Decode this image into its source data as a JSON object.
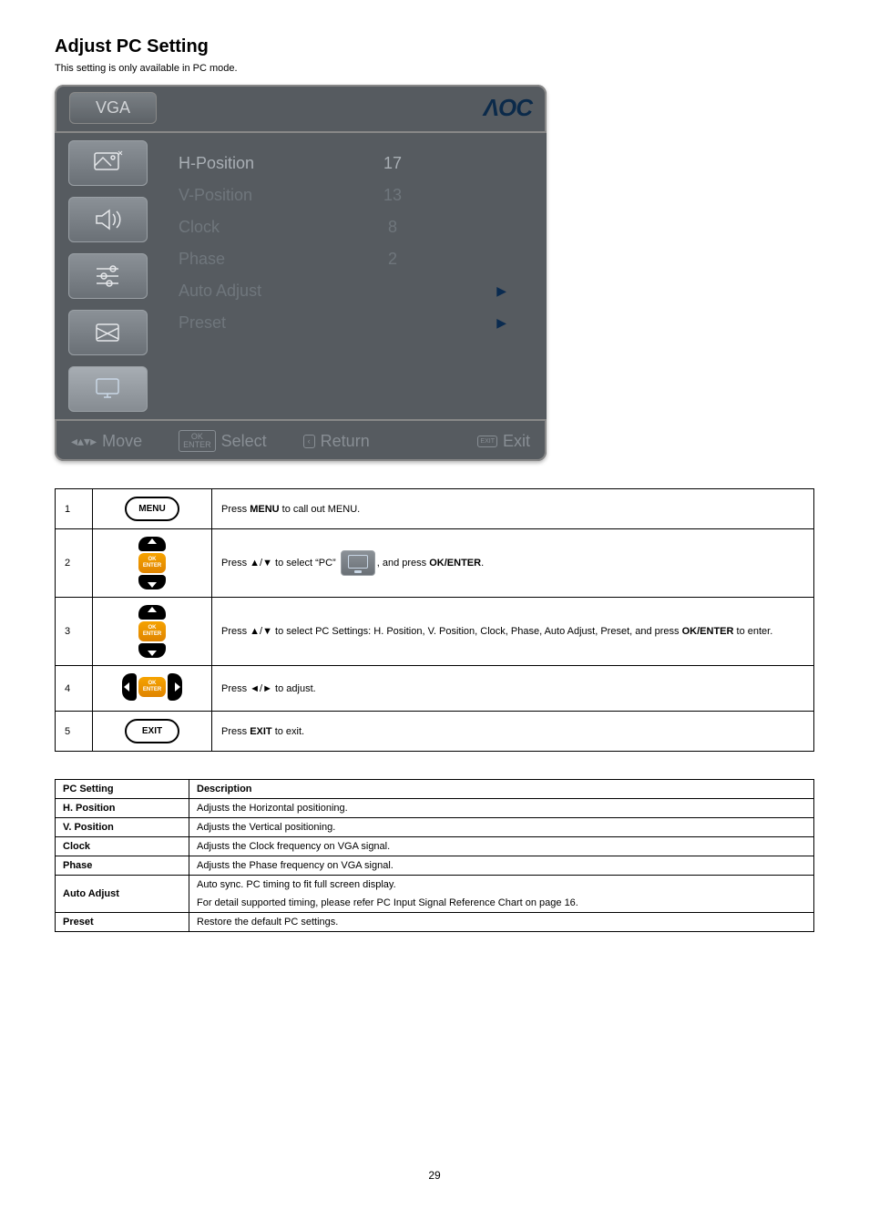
{
  "title": "Adjust PC Setting",
  "subtitle": "This setting is only available in PC mode.",
  "osd": {
    "tab": "VGA",
    "brand": "ΛOC",
    "rows": [
      {
        "label": "H-Position",
        "value": "17",
        "active": true
      },
      {
        "label": "V-Position",
        "value": "13",
        "active": false
      },
      {
        "label": "Clock",
        "value": "8",
        "active": false
      },
      {
        "label": "Phase",
        "value": "2",
        "active": false
      },
      {
        "label": "Auto Adjust",
        "value": "",
        "tri": "▶",
        "active": false
      },
      {
        "label": "Preset",
        "value": "",
        "tri": "▶",
        "active": false
      }
    ],
    "footer": {
      "move": "Move",
      "select": "Select",
      "select_key_top": "OK",
      "select_key_bot": "ENTER",
      "return": "Return",
      "return_key": "‹",
      "exit": "Exit",
      "exit_key": "EXIT"
    }
  },
  "steps": [
    {
      "num": "1",
      "btn": "MENU",
      "text_pre": "Press ",
      "text_b": "MENU",
      "text_post": " to call out MENU."
    },
    {
      "num": "2",
      "nav": "v",
      "text_pre": "Press ▲/▼ to select “PC” ",
      "inline_pc": true,
      "text_mid": ", and press ",
      "text_b": "OK/ENTER",
      "text_post": "."
    },
    {
      "num": "3",
      "nav": "v",
      "text_pre": "Press ▲/▼ to select PC Settings: H. Position, V. Position, Clock, Phase, Auto Adjust, Preset, and press ",
      "text_b": "OK/ENTER",
      "text_post": " to enter."
    },
    {
      "num": "4",
      "nav": "h",
      "text_pre": "Press ◄/► to adjust."
    },
    {
      "num": "5",
      "btn": "EXIT",
      "text_pre": "Press ",
      "text_b": "EXIT",
      "text_post": " to exit."
    }
  ],
  "desc": {
    "header": {
      "c1": "PC Setting",
      "c2": "Description"
    },
    "rows": [
      {
        "name": "H. Position",
        "desc": "Adjusts the Horizontal positioning."
      },
      {
        "name": "V. Position",
        "desc": "Adjusts the Vertical positioning."
      },
      {
        "name": "Clock",
        "desc": "Adjusts the Clock frequency on VGA signal."
      },
      {
        "name": "Phase",
        "desc": "Adjusts the Phase frequency on VGA signal."
      },
      {
        "name": "Auto Adjust",
        "desc": "Auto sync. PC timing to fit full screen display.\nFor detail supported timing, please refer PC Input Signal Reference Chart on page 16."
      },
      {
        "name": "Preset",
        "desc": "Restore the default PC settings."
      }
    ]
  },
  "page_number": "29"
}
